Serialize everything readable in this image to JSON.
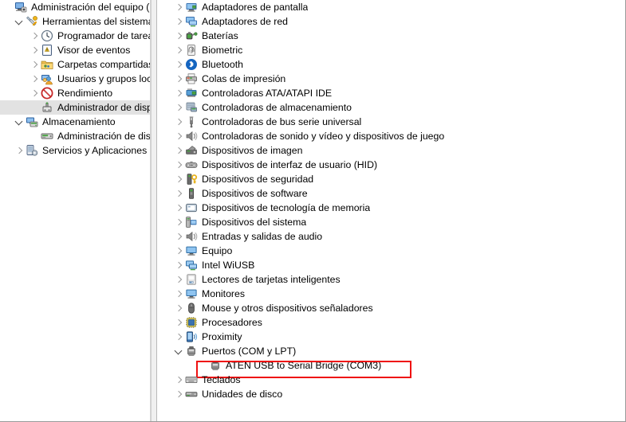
{
  "window": {
    "title": "Administración del equipo (loc",
    "app": "Administración del equipo"
  },
  "annotation": {
    "color": "#ef1111",
    "target_label": "ATEN USB to Serial Bridge (COM3)"
  },
  "console_tree": {
    "root": {
      "label": "Administración del equipo (loc",
      "icon": "computer-management-icon",
      "expanded": true
    },
    "items": [
      {
        "label": "Herramientas del sistema",
        "icon": "system-tools-icon",
        "level": 1,
        "state": "open",
        "selected": false
      },
      {
        "label": "Programador de tareas",
        "icon": "task-scheduler-icon",
        "level": 2,
        "state": "closed",
        "selected": false
      },
      {
        "label": "Visor de eventos",
        "icon": "event-viewer-icon",
        "level": 2,
        "state": "closed",
        "selected": false
      },
      {
        "label": "Carpetas compartidas",
        "icon": "shared-folders-icon",
        "level": 2,
        "state": "closed",
        "selected": false
      },
      {
        "label": "Usuarios y grupos local",
        "icon": "local-users-groups-icon",
        "level": 2,
        "state": "closed",
        "selected": false
      },
      {
        "label": "Rendimiento",
        "icon": "performance-icon",
        "level": 2,
        "state": "closed",
        "selected": false
      },
      {
        "label": "Administrador de dispo",
        "icon": "device-manager-icon",
        "level": 2,
        "state": "none",
        "selected": true
      },
      {
        "label": "Almacenamiento",
        "icon": "storage-icon",
        "level": 1,
        "state": "open",
        "selected": false
      },
      {
        "label": "Administración de disc",
        "icon": "disk-management-icon",
        "level": 2,
        "state": "none",
        "selected": false
      },
      {
        "label": "Servicios y Aplicaciones",
        "icon": "services-apps-icon",
        "level": 1,
        "state": "closed",
        "selected": false
      }
    ]
  },
  "device_tree": {
    "items": [
      {
        "label": "Adaptadores de pantalla",
        "icon": "display-adapter-icon",
        "level": 0,
        "state": "closed",
        "highlighted": false
      },
      {
        "label": "Adaptadores de red",
        "icon": "network-adapter-icon",
        "level": 0,
        "state": "closed",
        "highlighted": false
      },
      {
        "label": "Baterías",
        "icon": "battery-icon",
        "level": 0,
        "state": "closed",
        "highlighted": false
      },
      {
        "label": "Biometric",
        "icon": "fingerprint-icon",
        "level": 0,
        "state": "closed",
        "highlighted": false
      },
      {
        "label": "Bluetooth",
        "icon": "bluetooth-icon",
        "level": 0,
        "state": "closed",
        "highlighted": false
      },
      {
        "label": "Colas de impresión",
        "icon": "printer-icon",
        "level": 0,
        "state": "closed",
        "highlighted": false
      },
      {
        "label": "Controladoras ATA/ATAPI IDE",
        "icon": "ide-controller-icon",
        "level": 0,
        "state": "closed",
        "highlighted": false
      },
      {
        "label": "Controladoras de almacenamiento",
        "icon": "storage-controller-icon",
        "level": 0,
        "state": "closed",
        "highlighted": false
      },
      {
        "label": "Controladoras de bus serie universal",
        "icon": "usb-controller-icon",
        "level": 0,
        "state": "closed",
        "highlighted": false
      },
      {
        "label": "Controladoras de sonido y vídeo y dispositivos de juego",
        "icon": "sound-video-game-icon",
        "level": 0,
        "state": "closed",
        "highlighted": false
      },
      {
        "label": "Dispositivos de imagen",
        "icon": "imaging-device-icon",
        "level": 0,
        "state": "closed",
        "highlighted": false
      },
      {
        "label": "Dispositivos de interfaz de usuario (HID)",
        "icon": "hid-device-icon",
        "level": 0,
        "state": "closed",
        "highlighted": false
      },
      {
        "label": "Dispositivos de seguridad",
        "icon": "security-device-icon",
        "level": 0,
        "state": "closed",
        "highlighted": false
      },
      {
        "label": "Dispositivos de software",
        "icon": "software-device-icon",
        "level": 0,
        "state": "closed",
        "highlighted": false
      },
      {
        "label": "Dispositivos de tecnología de memoria",
        "icon": "memory-technology-icon",
        "level": 0,
        "state": "closed",
        "highlighted": false
      },
      {
        "label": "Dispositivos del sistema",
        "icon": "system-device-icon",
        "level": 0,
        "state": "closed",
        "highlighted": false
      },
      {
        "label": "Entradas y salidas de audio",
        "icon": "audio-io-icon",
        "level": 0,
        "state": "closed",
        "highlighted": false
      },
      {
        "label": "Equipo",
        "icon": "computer-icon",
        "level": 0,
        "state": "closed",
        "highlighted": false
      },
      {
        "label": "Intel WiUSB",
        "icon": "wiusb-icon",
        "level": 0,
        "state": "closed",
        "highlighted": false
      },
      {
        "label": "Lectores de tarjetas inteligentes",
        "icon": "smartcard-reader-icon",
        "level": 0,
        "state": "closed",
        "highlighted": false
      },
      {
        "label": "Monitores",
        "icon": "monitor-icon",
        "level": 0,
        "state": "closed",
        "highlighted": false
      },
      {
        "label": "Mouse y otros dispositivos señaladores",
        "icon": "mouse-icon",
        "level": 0,
        "state": "closed",
        "highlighted": false
      },
      {
        "label": "Procesadores",
        "icon": "processor-icon",
        "level": 0,
        "state": "closed",
        "highlighted": false
      },
      {
        "label": "Proximity",
        "icon": "proximity-icon",
        "level": 0,
        "state": "closed",
        "highlighted": false
      },
      {
        "label": "Puertos (COM y LPT)",
        "icon": "ports-icon",
        "level": 0,
        "state": "open",
        "highlighted": false
      },
      {
        "label": "ATEN USB to Serial Bridge (COM3)",
        "icon": "serial-port-icon",
        "level": 1,
        "state": "none",
        "highlighted": true
      },
      {
        "label": "Teclados",
        "icon": "keyboard-icon",
        "level": 0,
        "state": "closed",
        "highlighted": false
      },
      {
        "label": "Unidades de disco",
        "icon": "disk-drive-icon",
        "level": 0,
        "state": "closed",
        "highlighted": false
      }
    ]
  }
}
